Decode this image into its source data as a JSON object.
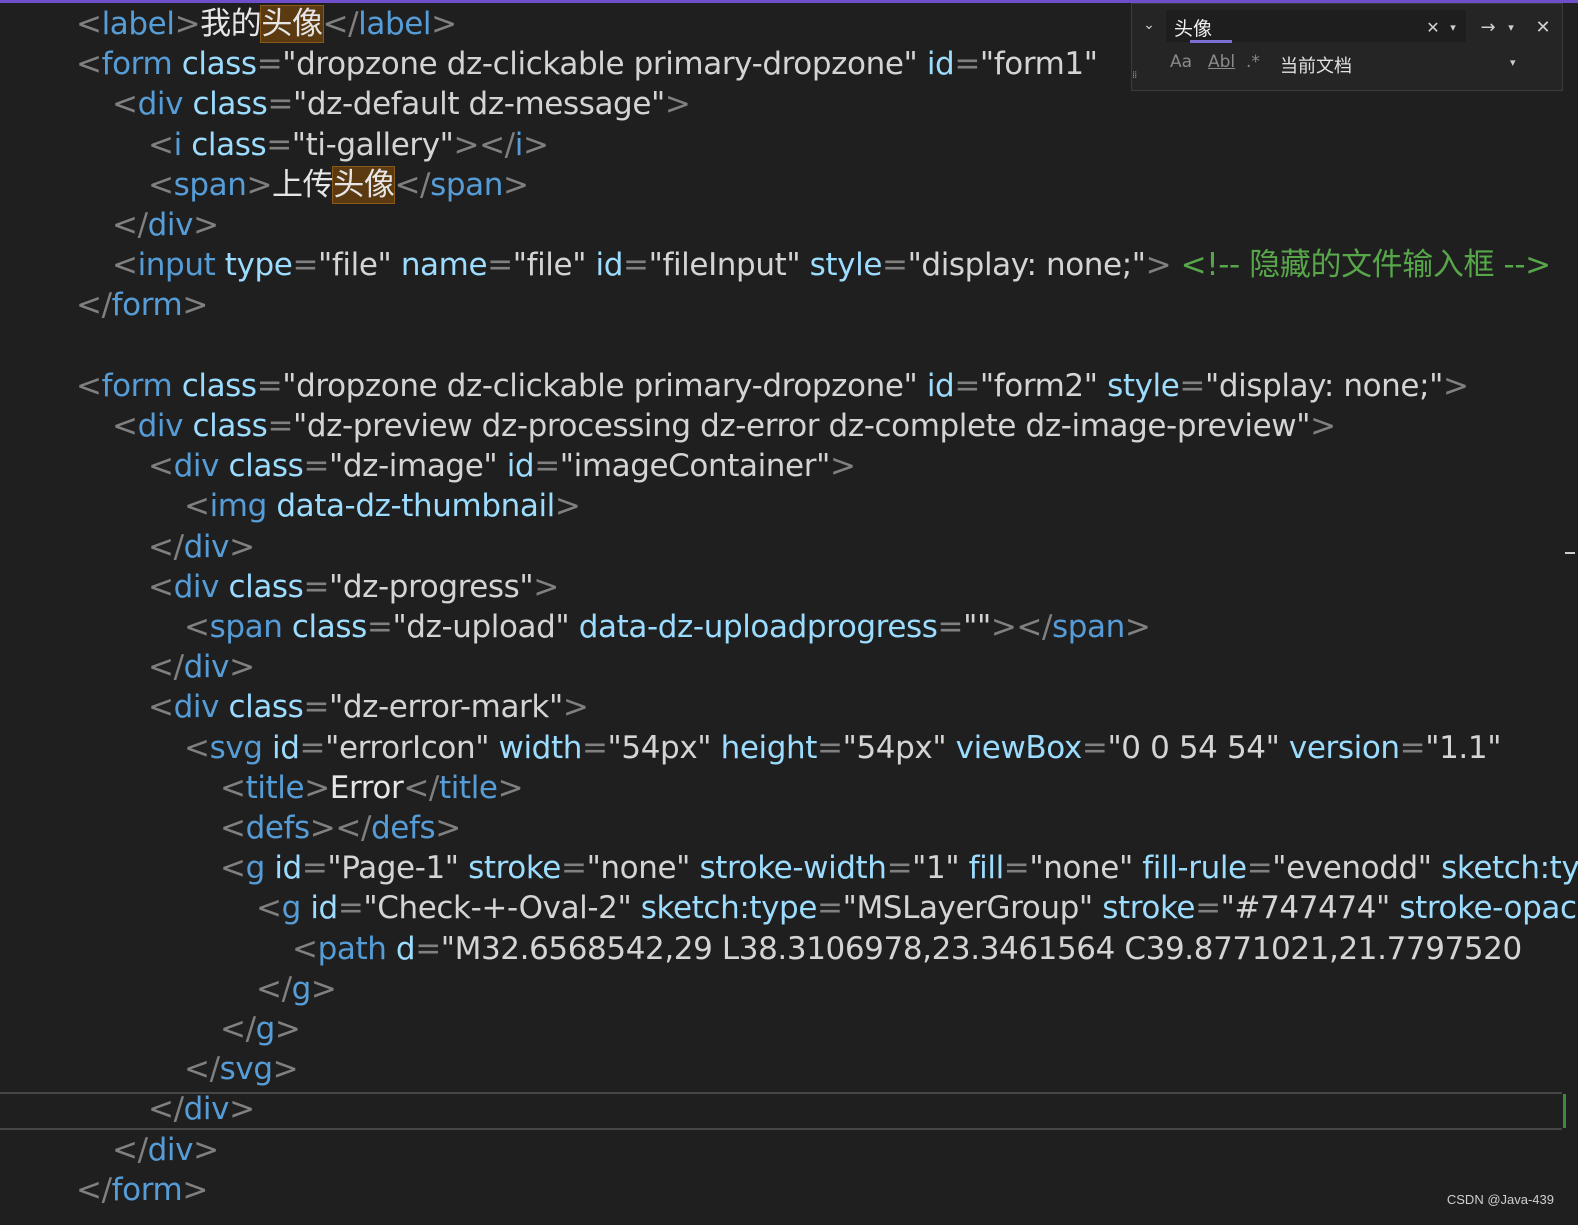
{
  "code": {
    "lines": [
      [
        {
          "c": "punct",
          "t": "<"
        },
        {
          "c": "tag",
          "t": "label"
        },
        {
          "c": "punct",
          "t": ">"
        },
        {
          "c": "txt cjk",
          "t": "我的"
        },
        {
          "c": "txt cjk hl",
          "t": "头像"
        },
        {
          "c": "punct",
          "t": "</"
        },
        {
          "c": "tag",
          "t": "label"
        },
        {
          "c": "punct",
          "t": ">"
        }
      ],
      [
        {
          "c": "punct",
          "t": "<"
        },
        {
          "c": "tag",
          "t": "form"
        },
        {
          "c": "attr",
          "t": " class"
        },
        {
          "c": "punct",
          "t": "="
        },
        {
          "c": "str",
          "t": "\"dropzone dz-clickable primary-dropzone\""
        },
        {
          "c": "attr",
          "t": " id"
        },
        {
          "c": "punct",
          "t": "="
        },
        {
          "c": "str",
          "t": "\"form1\""
        }
      ],
      [
        {
          "c": "punct",
          "t": "<"
        },
        {
          "c": "tag",
          "t": "div"
        },
        {
          "c": "attr",
          "t": " class"
        },
        {
          "c": "punct",
          "t": "="
        },
        {
          "c": "str",
          "t": "\"dz-default dz-message\""
        },
        {
          "c": "punct",
          "t": ">"
        }
      ],
      [
        {
          "c": "punct",
          "t": "<"
        },
        {
          "c": "tag",
          "t": "i"
        },
        {
          "c": "attr",
          "t": " class"
        },
        {
          "c": "punct",
          "t": "="
        },
        {
          "c": "str",
          "t": "\"ti-gallery\""
        },
        {
          "c": "punct",
          "t": "></"
        },
        {
          "c": "tag",
          "t": "i"
        },
        {
          "c": "punct",
          "t": ">"
        }
      ],
      [
        {
          "c": "punct",
          "t": "<"
        },
        {
          "c": "tag",
          "t": "span"
        },
        {
          "c": "punct",
          "t": ">"
        },
        {
          "c": "txt cjk",
          "t": "上传"
        },
        {
          "c": "txt cjk hl",
          "t": "头像"
        },
        {
          "c": "punct",
          "t": "</"
        },
        {
          "c": "tag",
          "t": "span"
        },
        {
          "c": "punct",
          "t": ">"
        }
      ],
      [
        {
          "c": "punct",
          "t": "</"
        },
        {
          "c": "tag",
          "t": "div"
        },
        {
          "c": "punct",
          "t": ">"
        }
      ],
      [
        {
          "c": "punct",
          "t": "<"
        },
        {
          "c": "tag",
          "t": "input"
        },
        {
          "c": "attr",
          "t": " type"
        },
        {
          "c": "punct",
          "t": "="
        },
        {
          "c": "str",
          "t": "\"file\""
        },
        {
          "c": "attr",
          "t": " name"
        },
        {
          "c": "punct",
          "t": "="
        },
        {
          "c": "str",
          "t": "\"file\""
        },
        {
          "c": "attr",
          "t": " id"
        },
        {
          "c": "punct",
          "t": "="
        },
        {
          "c": "str",
          "t": "\"fileInput\""
        },
        {
          "c": "attr",
          "t": " style"
        },
        {
          "c": "punct",
          "t": "="
        },
        {
          "c": "str",
          "t": "\"display: none;\""
        },
        {
          "c": "punct",
          "t": ">"
        },
        {
          "c": "comment",
          "t": " <!-- "
        },
        {
          "c": "comment cjk",
          "t": "隐藏的文件输入框"
        },
        {
          "c": "comment",
          "t": " -->"
        }
      ],
      [
        {
          "c": "punct",
          "t": "</"
        },
        {
          "c": "tag",
          "t": "form"
        },
        {
          "c": "punct",
          "t": ">"
        }
      ],
      [],
      [
        {
          "c": "punct",
          "t": "<"
        },
        {
          "c": "tag",
          "t": "form"
        },
        {
          "c": "attr",
          "t": " class"
        },
        {
          "c": "punct",
          "t": "="
        },
        {
          "c": "str",
          "t": "\"dropzone dz-clickable primary-dropzone\""
        },
        {
          "c": "attr",
          "t": " id"
        },
        {
          "c": "punct",
          "t": "="
        },
        {
          "c": "str",
          "t": "\"form2\""
        },
        {
          "c": "attr",
          "t": " style"
        },
        {
          "c": "punct",
          "t": "="
        },
        {
          "c": "str",
          "t": "\"display: none;\""
        },
        {
          "c": "punct",
          "t": ">"
        }
      ],
      [
        {
          "c": "punct",
          "t": "<"
        },
        {
          "c": "tag",
          "t": "div"
        },
        {
          "c": "attr",
          "t": " class"
        },
        {
          "c": "punct",
          "t": "="
        },
        {
          "c": "str",
          "t": "\"dz-preview dz-processing dz-error dz-complete dz-image-preview\""
        },
        {
          "c": "punct",
          "t": ">"
        }
      ],
      [
        {
          "c": "punct",
          "t": "<"
        },
        {
          "c": "tag",
          "t": "div"
        },
        {
          "c": "attr",
          "t": " class"
        },
        {
          "c": "punct",
          "t": "="
        },
        {
          "c": "str",
          "t": "\"dz-image\""
        },
        {
          "c": "attr",
          "t": " id"
        },
        {
          "c": "punct",
          "t": "="
        },
        {
          "c": "str",
          "t": "\"imageContainer\""
        },
        {
          "c": "punct",
          "t": ">"
        }
      ],
      [
        {
          "c": "punct",
          "t": "<"
        },
        {
          "c": "tag",
          "t": "img"
        },
        {
          "c": "attr",
          "t": " data-dz-thumbnail"
        },
        {
          "c": "punct",
          "t": ">"
        }
      ],
      [
        {
          "c": "punct",
          "t": "</"
        },
        {
          "c": "tag",
          "t": "div"
        },
        {
          "c": "punct",
          "t": ">"
        }
      ],
      [
        {
          "c": "punct",
          "t": "<"
        },
        {
          "c": "tag",
          "t": "div"
        },
        {
          "c": "attr",
          "t": " class"
        },
        {
          "c": "punct",
          "t": "="
        },
        {
          "c": "str",
          "t": "\"dz-progress\""
        },
        {
          "c": "punct",
          "t": ">"
        }
      ],
      [
        {
          "c": "punct",
          "t": "<"
        },
        {
          "c": "tag",
          "t": "span"
        },
        {
          "c": "attr",
          "t": " class"
        },
        {
          "c": "punct",
          "t": "="
        },
        {
          "c": "str",
          "t": "\"dz-upload\""
        },
        {
          "c": "attr",
          "t": " data-dz-uploadprogress"
        },
        {
          "c": "punct",
          "t": "="
        },
        {
          "c": "str",
          "t": "\"\""
        },
        {
          "c": "punct",
          "t": "></"
        },
        {
          "c": "tag",
          "t": "span"
        },
        {
          "c": "punct",
          "t": ">"
        }
      ],
      [
        {
          "c": "punct",
          "t": "</"
        },
        {
          "c": "tag",
          "t": "div"
        },
        {
          "c": "punct",
          "t": ">"
        }
      ],
      [
        {
          "c": "punct",
          "t": "<"
        },
        {
          "c": "tag",
          "t": "div"
        },
        {
          "c": "attr",
          "t": " class"
        },
        {
          "c": "punct",
          "t": "="
        },
        {
          "c": "str",
          "t": "\"dz-error-mark\""
        },
        {
          "c": "punct",
          "t": ">"
        }
      ],
      [
        {
          "c": "punct",
          "t": "<"
        },
        {
          "c": "tag",
          "t": "svg"
        },
        {
          "c": "attr",
          "t": " id"
        },
        {
          "c": "punct",
          "t": "="
        },
        {
          "c": "str",
          "t": "\"errorIcon\""
        },
        {
          "c": "attr",
          "t": " width"
        },
        {
          "c": "punct",
          "t": "="
        },
        {
          "c": "str",
          "t": "\"54px\""
        },
        {
          "c": "attr",
          "t": " height"
        },
        {
          "c": "punct",
          "t": "="
        },
        {
          "c": "str",
          "t": "\"54px\""
        },
        {
          "c": "attr",
          "t": " viewBox"
        },
        {
          "c": "punct",
          "t": "="
        },
        {
          "c": "str",
          "t": "\"0 0 54 54\""
        },
        {
          "c": "attr",
          "t": " version"
        },
        {
          "c": "punct",
          "t": "="
        },
        {
          "c": "str",
          "t": "\"1.1\""
        }
      ],
      [
        {
          "c": "punct",
          "t": "<"
        },
        {
          "c": "tag",
          "t": "title"
        },
        {
          "c": "punct",
          "t": ">"
        },
        {
          "c": "txt",
          "t": "Error"
        },
        {
          "c": "punct",
          "t": "</"
        },
        {
          "c": "tag",
          "t": "title"
        },
        {
          "c": "punct",
          "t": ">"
        }
      ],
      [
        {
          "c": "punct",
          "t": "<"
        },
        {
          "c": "tag",
          "t": "defs"
        },
        {
          "c": "punct",
          "t": "></"
        },
        {
          "c": "tag",
          "t": "defs"
        },
        {
          "c": "punct",
          "t": ">"
        }
      ],
      [
        {
          "c": "punct",
          "t": "<"
        },
        {
          "c": "tag",
          "t": "g"
        },
        {
          "c": "attr",
          "t": " id"
        },
        {
          "c": "punct",
          "t": "="
        },
        {
          "c": "str",
          "t": "\"Page-1\""
        },
        {
          "c": "attr",
          "t": " stroke"
        },
        {
          "c": "punct",
          "t": "="
        },
        {
          "c": "str",
          "t": "\"none\""
        },
        {
          "c": "attr",
          "t": " stroke-width"
        },
        {
          "c": "punct",
          "t": "="
        },
        {
          "c": "str",
          "t": "\"1\""
        },
        {
          "c": "attr",
          "t": " fill"
        },
        {
          "c": "punct",
          "t": "="
        },
        {
          "c": "str",
          "t": "\"none\""
        },
        {
          "c": "attr",
          "t": " fill-rule"
        },
        {
          "c": "punct",
          "t": "="
        },
        {
          "c": "str",
          "t": "\"evenodd\""
        },
        {
          "c": "attr",
          "t": " sketch:type"
        }
      ],
      [
        {
          "c": "punct",
          "t": "<"
        },
        {
          "c": "tag",
          "t": "g"
        },
        {
          "c": "attr",
          "t": " id"
        },
        {
          "c": "punct",
          "t": "="
        },
        {
          "c": "str",
          "t": "\"Check-+-Oval-2\""
        },
        {
          "c": "attr",
          "t": " sketch:type"
        },
        {
          "c": "punct",
          "t": "="
        },
        {
          "c": "str",
          "t": "\"MSLayerGroup\""
        },
        {
          "c": "attr",
          "t": " stroke"
        },
        {
          "c": "punct",
          "t": "="
        },
        {
          "c": "str",
          "t": "\"#747474\""
        },
        {
          "c": "attr",
          "t": " stroke-opacity"
        }
      ],
      [
        {
          "c": "punct",
          "t": "<"
        },
        {
          "c": "tag",
          "t": "path"
        },
        {
          "c": "attr",
          "t": " d"
        },
        {
          "c": "punct",
          "t": "="
        },
        {
          "c": "str",
          "t": "\"M32.6568542,29 L38.3106978,23.3461564 C39.8771021,21.7797520"
        }
      ],
      [
        {
          "c": "punct",
          "t": "</"
        },
        {
          "c": "tag",
          "t": "g"
        },
        {
          "c": "punct",
          "t": ">"
        }
      ],
      [
        {
          "c": "punct",
          "t": "</"
        },
        {
          "c": "tag",
          "t": "g"
        },
        {
          "c": "punct",
          "t": ">"
        }
      ],
      [
        {
          "c": "punct",
          "t": "</"
        },
        {
          "c": "tag",
          "t": "svg"
        },
        {
          "c": "punct",
          "t": ">"
        }
      ],
      [
        {
          "c": "punct",
          "t": "</"
        },
        {
          "c": "tag",
          "t": "div"
        },
        {
          "c": "punct",
          "t": ">"
        }
      ],
      [
        {
          "c": "punct",
          "t": "</"
        },
        {
          "c": "tag",
          "t": "div"
        },
        {
          "c": "punct",
          "t": ">"
        }
      ],
      [
        {
          "c": "punct",
          "t": "</"
        },
        {
          "c": "tag",
          "t": "form"
        },
        {
          "c": "punct",
          "t": ">"
        }
      ]
    ]
  },
  "find": {
    "query": "头像",
    "scope": "当前文档",
    "match_case_label": "Aa",
    "whole_word_label": "Abl",
    "regex_label": ".*",
    "toggle_glyph": "⌄",
    "clear_glyph": "✕",
    "dropdown_glyph": "▾",
    "next_glyph": "→",
    "close_glyph": "✕"
  },
  "watermark": "CSDN @Java-439",
  "colors": {
    "background": "#1f1f1f",
    "tag": "#569cd6",
    "attribute": "#9cdcfe",
    "string": "#d4d4d4",
    "punctuation": "#808080",
    "comment": "#57a64a",
    "highlight": "#5b3a12",
    "accent": "#6f4fc9"
  }
}
